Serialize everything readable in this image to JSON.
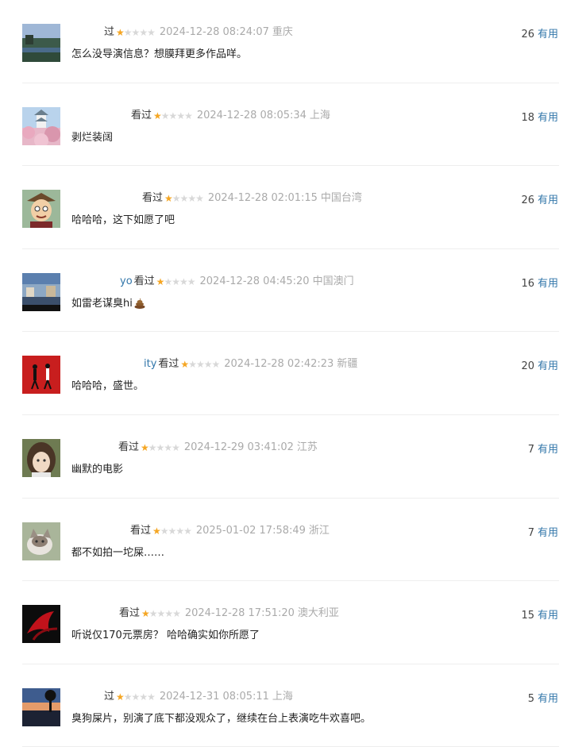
{
  "comments": [
    {
      "user": "",
      "status": "过",
      "rating": 1,
      "time": "2024-12-28 08:24:07",
      "location": "重庆",
      "content": "怎么没导演信息？想膜拜更多作品咩。",
      "votes": "26",
      "vote_label": "有用",
      "avatar": "lake-landscape",
      "emoji": ""
    },
    {
      "user": "",
      "status": "看过",
      "rating": 1,
      "time": "2024-12-28 08:05:34",
      "location": "上海",
      "content": "剥烂装阔",
      "votes": "18",
      "vote_label": "有用",
      "avatar": "castle-cherry-blossom",
      "emoji": ""
    },
    {
      "user": "",
      "status": "看过",
      "rating": 1,
      "time": "2024-12-28 02:01:15",
      "location": "中国台湾",
      "content": "哈哈哈，这下如愿了吧",
      "votes": "26",
      "vote_label": "有用",
      "avatar": "cartoon-character",
      "emoji": ""
    },
    {
      "user": "yo",
      "status": "看过",
      "rating": 1,
      "time": "2024-12-28 04:45:20",
      "location": "中国澳门",
      "content": "如雷老谋臭hi",
      "votes": "16",
      "vote_label": "有用",
      "avatar": "painting-scene",
      "emoji": "poop-emoji"
    },
    {
      "user": "ity",
      "status": "看过",
      "rating": 1,
      "time": "2024-12-28 02:42:23",
      "location": "新疆",
      "content": "哈哈哈，盛世。",
      "votes": "20",
      "vote_label": "有用",
      "avatar": "dancing-couple-red",
      "emoji": ""
    },
    {
      "user": "",
      "status": "看过",
      "rating": 1,
      "time": "2024-12-29 03:41:02",
      "location": "江苏",
      "content": "幽默的电影",
      "votes": "7",
      "vote_label": "有用",
      "avatar": "child-portrait",
      "emoji": ""
    },
    {
      "user": "",
      "status": "看过",
      "rating": 1,
      "time": "2025-01-02 17:58:49",
      "location": "浙江",
      "content": "都不如拍一坨屎……",
      "votes": "7",
      "vote_label": "有用",
      "avatar": "cat-photo",
      "emoji": ""
    },
    {
      "user": "",
      "status": "看过",
      "rating": 1,
      "time": "2024-12-28 17:51:20",
      "location": "澳大利亚",
      "content": "听说仅170元票房？ 哈哈确实如你所愿了",
      "votes": "15",
      "vote_label": "有用",
      "avatar": "red-dark-abstract",
      "emoji": ""
    },
    {
      "user": "",
      "status": "过",
      "rating": 1,
      "time": "2024-12-31 08:05:11",
      "location": "上海",
      "content": "臭狗屎片，别演了底下都没观众了，继续在台上表演吃牛欢喜吧。",
      "votes": "5",
      "vote_label": "有用",
      "avatar": "sunset-tree-silhouette",
      "emoji": ""
    }
  ]
}
